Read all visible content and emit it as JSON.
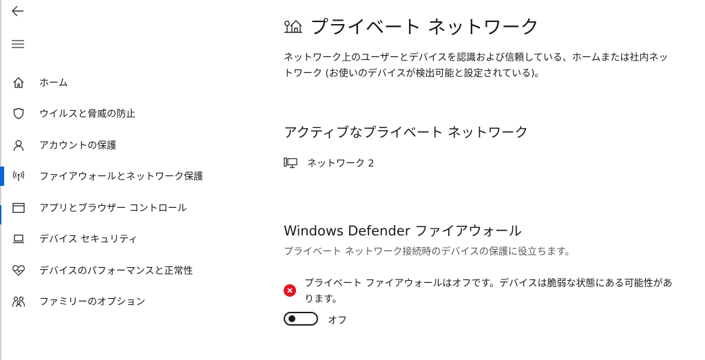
{
  "window": {
    "active_section": "firewall"
  },
  "sidebar": {
    "items": [
      {
        "id": "home",
        "label": "ホーム",
        "icon": "home-icon"
      },
      {
        "id": "virus",
        "label": "ウイルスと脅威の防止",
        "icon": "shield-icon"
      },
      {
        "id": "account",
        "label": "アカウントの保護",
        "icon": "person-icon"
      },
      {
        "id": "firewall",
        "label": "ファイアウォールとネットワーク保護",
        "icon": "antenna-icon"
      },
      {
        "id": "app",
        "label": "アプリとブラウザー コントロール",
        "icon": "browser-window-icon"
      },
      {
        "id": "device",
        "label": "デバイス セキュリティ",
        "icon": "laptop-icon"
      },
      {
        "id": "health",
        "label": "デバイスのパフォーマンスと正常性",
        "icon": "heart-pulse-icon"
      },
      {
        "id": "family",
        "label": "ファミリーのオプション",
        "icon": "family-icon"
      }
    ]
  },
  "main": {
    "title": "プライベート ネットワーク",
    "description": "ネットワーク上のユーザーとデバイスを認識および信頼している、ホームまたは社内ネットワーク (お使いのデバイスが検出可能と設定されている)。",
    "active_heading": "アクティブなプライベート ネットワーク",
    "network_name": "ネットワーク 2",
    "defender_heading": "Windows Defender ファイアウォール",
    "defender_sub": "プライベート ネットワーク接続時のデバイスの保護に役立ちます。",
    "alert_text": "プライベート ファイアウォールはオフです。デバイスは脆弱な状態にある可能性があります。",
    "toggle_label": "オフ",
    "toggle_on": false
  },
  "colors": {
    "accent": "#0a63d8",
    "error": "#e81123",
    "text": "#1a1a1a",
    "subtext": "#5a5a5a"
  }
}
